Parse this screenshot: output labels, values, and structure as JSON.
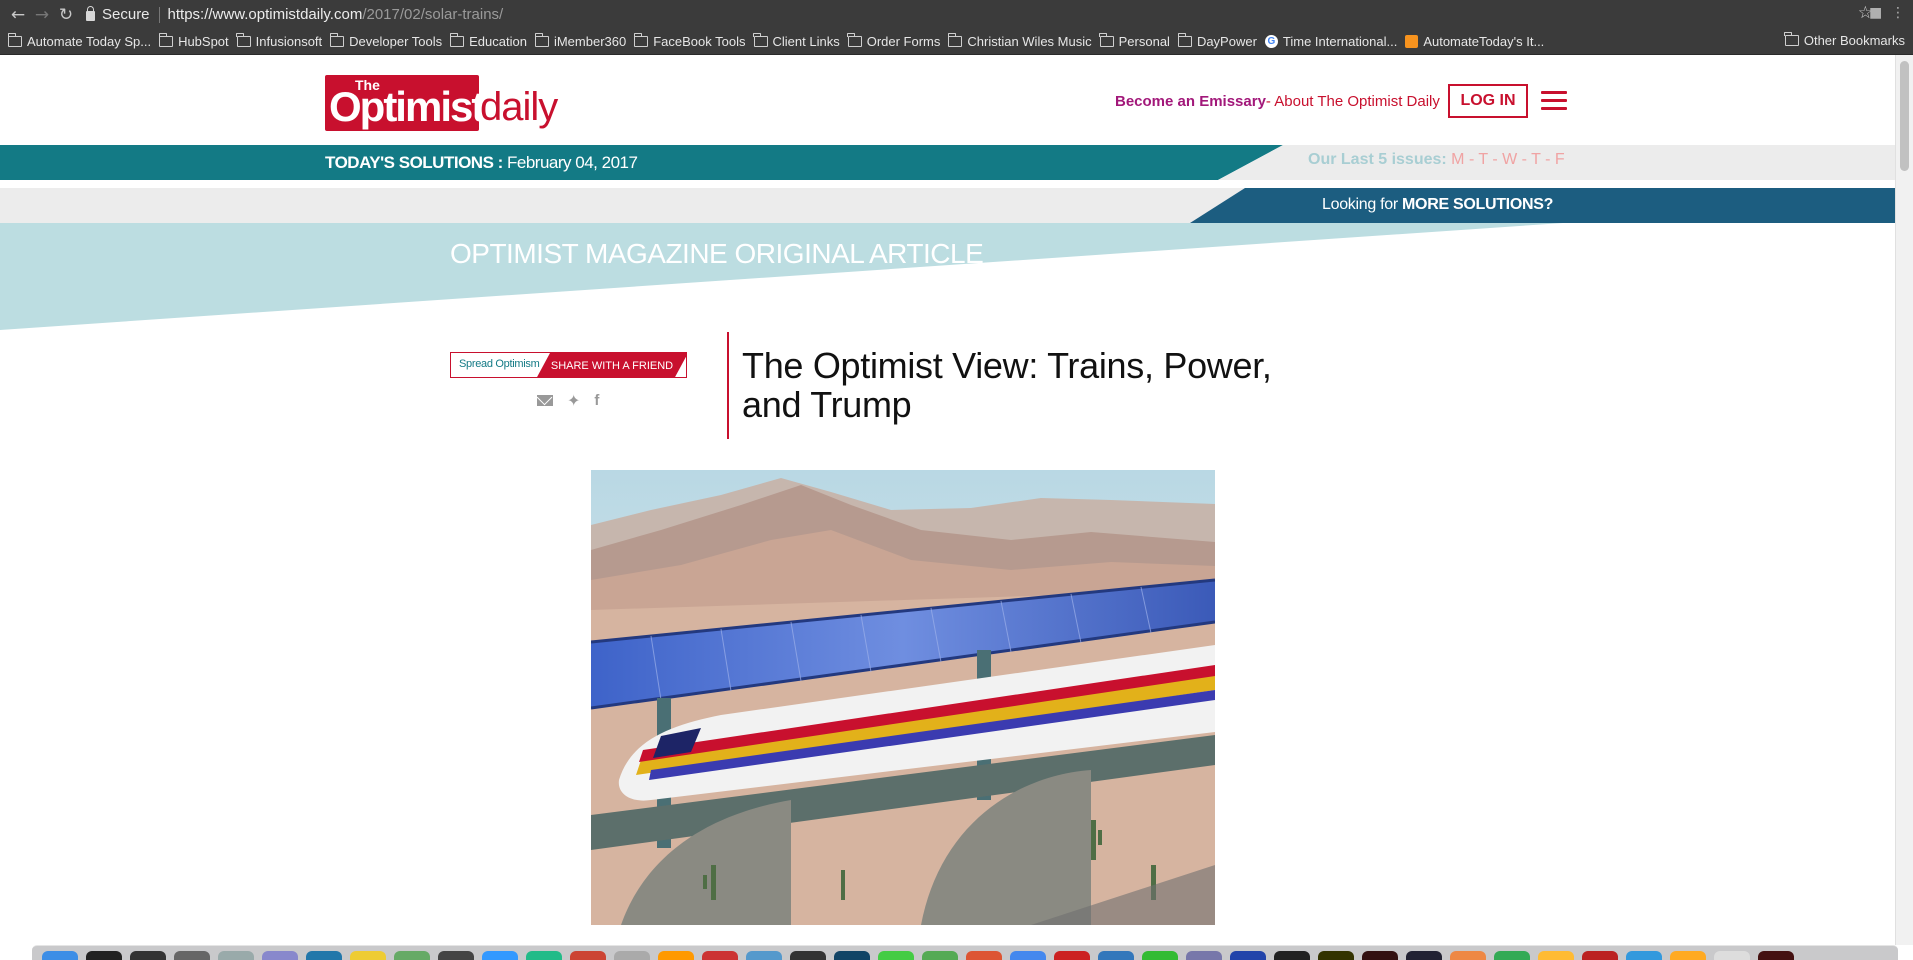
{
  "browser": {
    "secure_label": "Secure",
    "url_host": "https://www.optimistdaily.com",
    "url_path": "/2017/02/solar-trains/"
  },
  "bookmarks": [
    {
      "label": "Automate Today Sp...",
      "icon": "folder-icon"
    },
    {
      "label": "HubSpot",
      "icon": "folder-icon"
    },
    {
      "label": "Infusionsoft",
      "icon": "folder-icon"
    },
    {
      "label": "Developer Tools",
      "icon": "folder-icon"
    },
    {
      "label": "Education",
      "icon": "folder-icon"
    },
    {
      "label": "iMember360",
      "icon": "folder-icon"
    },
    {
      "label": "FaceBook Tools",
      "icon": "folder-icon"
    },
    {
      "label": "Client Links",
      "icon": "folder-icon"
    },
    {
      "label": "Order Forms",
      "icon": "folder-icon"
    },
    {
      "label": "Christian Wiles Music",
      "icon": "folder-icon"
    },
    {
      "label": "Personal",
      "icon": "folder-icon"
    },
    {
      "label": "DayPower",
      "icon": "folder-icon"
    },
    {
      "label": "Time International...",
      "icon": "google-icon"
    },
    {
      "label": "AutomateToday's It...",
      "icon": "rss-icon"
    }
  ],
  "bookmarks_other": "Other Bookmarks",
  "site": {
    "logo_the": "The",
    "logo_optimist": "Optimist",
    "logo_daily": "daily",
    "emissary_link": "Become an Emissary",
    "about_link": " - About The Optimist Daily",
    "login_label": "LOG IN"
  },
  "solutions": {
    "today_label": "TODAY'S SOLUTIONS : ",
    "today_date": "February 04, 2017",
    "last_issues_label": "Our Last 5 issues: ",
    "issue_days": "M - T - W - T - F",
    "more_prefix": "Looking for ",
    "more_bold": "MORE SOLUTIONS?"
  },
  "article": {
    "band_label": "OPTIMIST MAGAZINE ORIGINAL ARTICLE",
    "spread_label": "Spread Optimism",
    "share_label": "SHARE WITH A FRIEND",
    "title": "The Optimist View: Trains, Power, and Trump"
  },
  "colors": {
    "brand_red": "#c8102e",
    "teal": "#137a85",
    "navy": "#1c5d80",
    "emissary_purple": "#a2187a"
  }
}
